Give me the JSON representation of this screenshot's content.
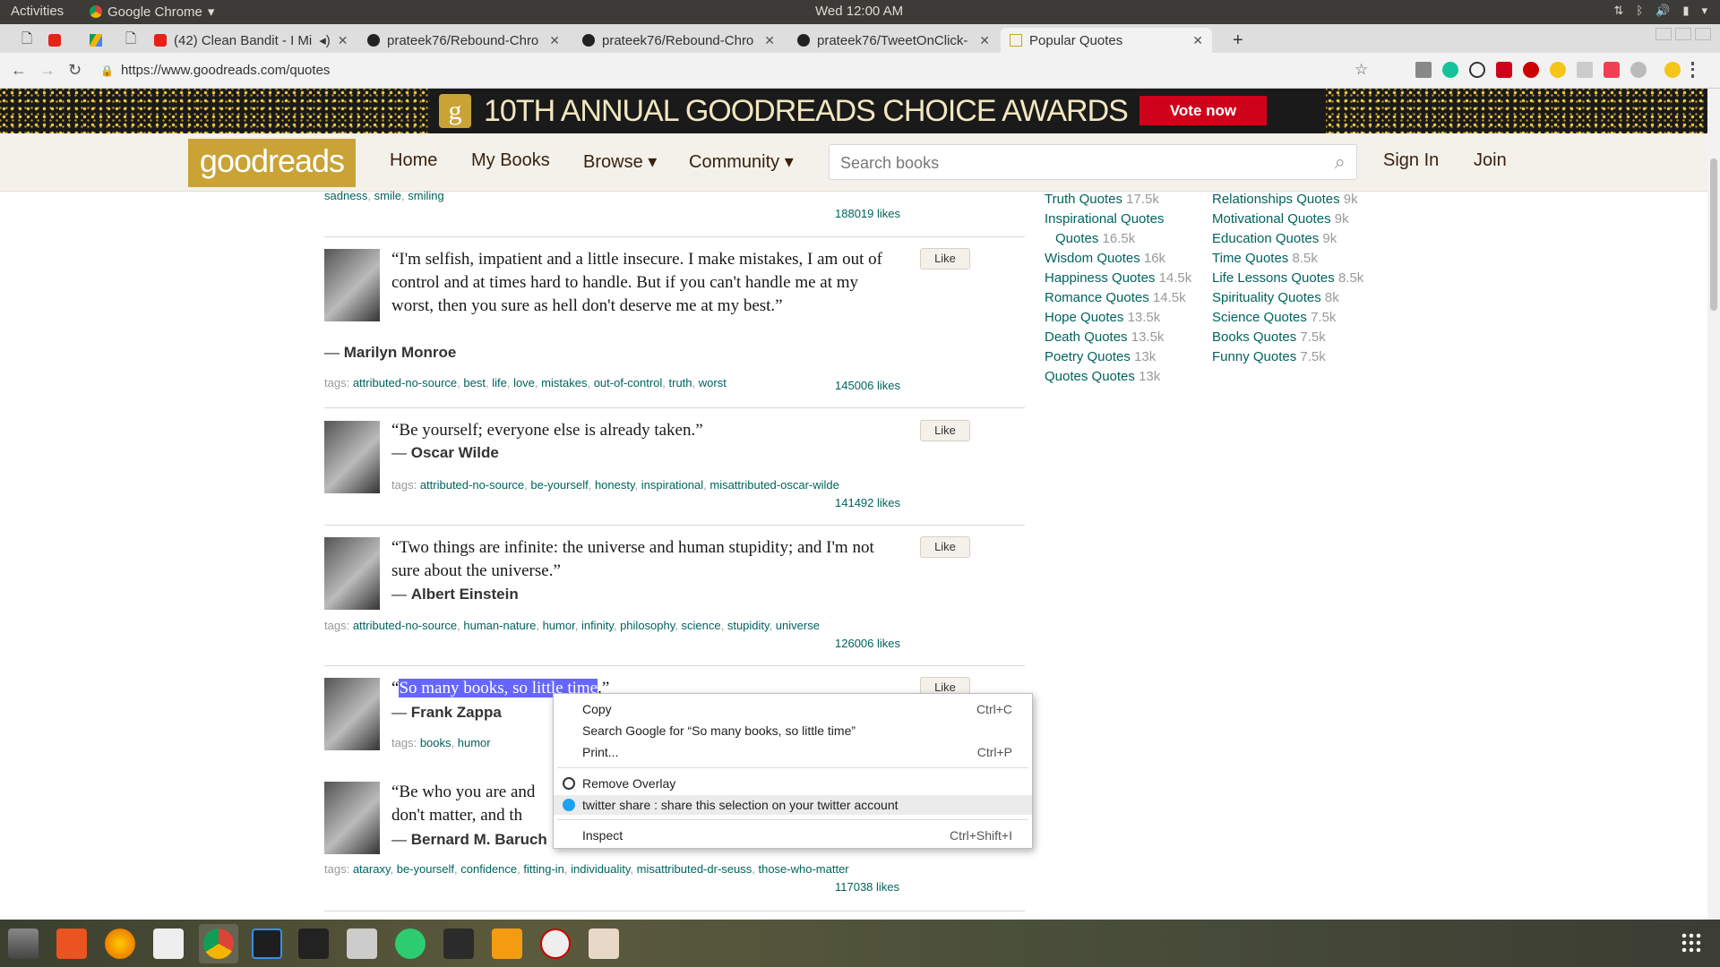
{
  "system": {
    "activities": "Activities",
    "app": "Google Chrome",
    "clock": "Wed 12:00 AM"
  },
  "tabs": [
    {
      "label": ""
    },
    {
      "label": ""
    },
    {
      "label": ""
    },
    {
      "label": ""
    },
    {
      "label": "(42) Clean Bandit - I Mi"
    },
    {
      "label": "prateek76/Rebound-Chro"
    },
    {
      "label": "prateek76/Rebound-Chro"
    },
    {
      "label": "prateek76/TweetOnClick-"
    },
    {
      "label": "Popular Quotes"
    }
  ],
  "address": {
    "url": "https://www.goodreads.com/quotes"
  },
  "banner": {
    "title": "10TH ANNUAL GOODREADS CHOICE AWARDS",
    "vote": "Vote now",
    "logo_letter": "g"
  },
  "header": {
    "logo": "goodreads",
    "nav": [
      "Home",
      "My Books",
      "Browse ▾",
      "Community ▾"
    ],
    "search_placeholder": "Search books",
    "signin": "Sign In",
    "join": "Join"
  },
  "top": {
    "tags": [
      "sadness",
      "smile",
      "smiling"
    ],
    "likes": "188019 likes"
  },
  "quotes": [
    {
      "text": "“I'm selfish, impatient and a little insecure. I make mistakes, I am out of control and at times hard to handle. But if you can't handle me at my worst, then you sure as hell don't deserve me at my best.”",
      "author": "Marilyn Monroe",
      "tags_label": "tags:",
      "tags": [
        "attributed-no-source",
        "best",
        "life",
        "love",
        "mistakes",
        "out-of-control",
        "truth",
        "worst"
      ],
      "likes": "145006 likes",
      "like": "Like"
    },
    {
      "text": "“Be yourself; everyone else is already taken.”",
      "author": "Oscar Wilde",
      "tags_label": "tags:",
      "tags": [
        "attributed-no-source",
        "be-yourself",
        "honesty",
        "inspirational",
        "misattributed-oscar-wilde"
      ],
      "likes": "141492 likes",
      "like": "Like"
    },
    {
      "text": "“Two things are infinite: the universe and human stupidity; and I'm not sure about the universe.”",
      "author": "Albert Einstein",
      "tags_label": "tags:",
      "tags": [
        "attributed-no-source",
        "human-nature",
        "humor",
        "infinity",
        "philosophy",
        "science",
        "stupidity",
        "universe"
      ],
      "likes": "126006 likes",
      "like": "Like"
    },
    {
      "text_open": "“",
      "text_sel": "So many books, so little time",
      "text_close": ".”",
      "author": "Frank Zappa",
      "tags_label": "tags:",
      "tags": [
        "books",
        "humor"
      ],
      "like": "Like"
    },
    {
      "text": "“Be who you are and",
      "text2": "don't matter, and th",
      "author": "Bernard M. Baruch",
      "tags_label": "tags:",
      "tags": [
        "ataraxy",
        "be-yourself",
        "confidence",
        "fitting-in",
        "individuality",
        "misattributed-dr-seuss",
        "those-who-matter"
      ],
      "likes": "117038 likes"
    }
  ],
  "sidebar": {
    "col1": [
      {
        "label": "Truth Quotes",
        "count": "17.5k"
      },
      {
        "label": "Inspirational Quotes",
        "label2": "Quotes",
        "count": "16.5k"
      },
      {
        "label": "Wisdom Quotes",
        "count": "16k"
      },
      {
        "label": "Happiness Quotes",
        "count": "14.5k"
      },
      {
        "label": "Romance Quotes",
        "count": "14.5k"
      },
      {
        "label": "Hope Quotes",
        "count": "13.5k"
      },
      {
        "label": "Death Quotes",
        "count": "13.5k"
      },
      {
        "label": "Poetry Quotes",
        "count": "13k"
      },
      {
        "label": "Quotes Quotes",
        "count": "13k"
      }
    ],
    "col2": [
      {
        "label": "Relationships Quotes",
        "count": "9k"
      },
      {
        "label": "Motivational Quotes",
        "count": "9k"
      },
      {
        "label": "Education Quotes",
        "count": "9k"
      },
      {
        "label": "Time Quotes",
        "count": "8.5k"
      },
      {
        "label": "Life Lessons Quotes",
        "count": "8.5k"
      },
      {
        "label": "Spirituality Quotes",
        "count": "8k"
      },
      {
        "label": "Science Quotes",
        "count": "7.5k"
      },
      {
        "label": "Books Quotes",
        "count": "7.5k"
      },
      {
        "label": "Funny Quotes",
        "count": "7.5k"
      }
    ]
  },
  "context_menu": {
    "copy": "Copy",
    "copy_sc": "Ctrl+C",
    "search": "Search Google for “So many books, so little time”",
    "print": "Print...",
    "print_sc": "Ctrl+P",
    "remove_overlay": "Remove Overlay",
    "twitter": "twitter share : share this selection on your twitter account",
    "inspect": "Inspect",
    "inspect_sc": "Ctrl+Shift+I"
  },
  "colors": {
    "accent": "#00635d",
    "banner_red": "#d0021b",
    "header_bg": "#f4f1ea",
    "selection": "#6666ff"
  }
}
